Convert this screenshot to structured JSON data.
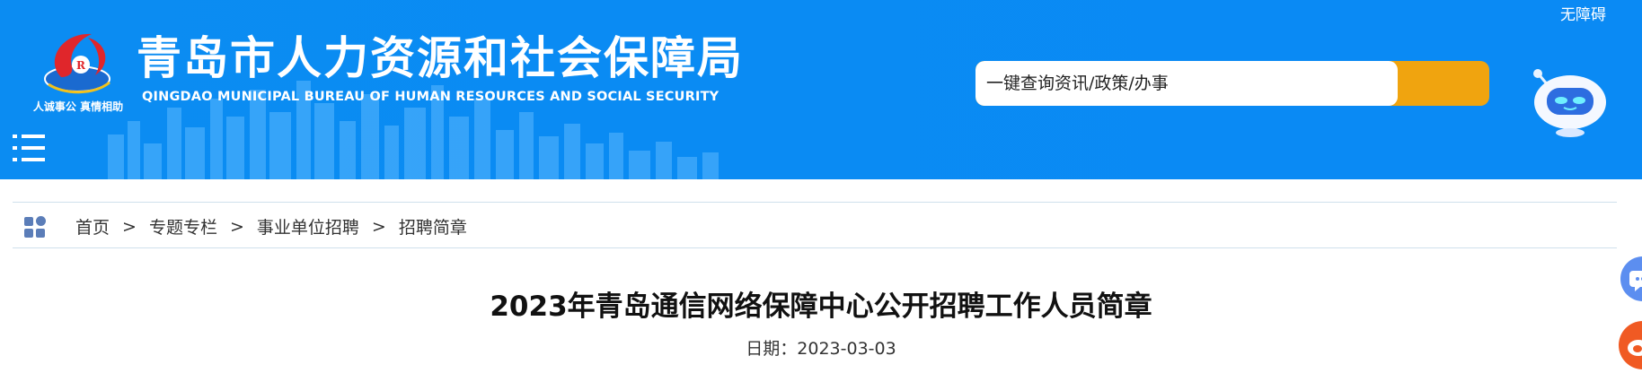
{
  "header": {
    "accessibility_label": "无障碍",
    "site_title": "青岛市人力资源和社会保障局",
    "site_subtitle": "QINGDAO MUNICIPAL BUREAU OF HUMAN RESOURCES AND SOCIAL SECURITY",
    "logo_caption": "人诚事公  真情相助",
    "logo_icon": "bureau-logo-icon",
    "menu_icon": "menu-icon",
    "robot_icon": "robot-assistant-icon",
    "colors": {
      "header_bg": "#0b8cf2",
      "search_button": "#f0a40f"
    }
  },
  "search": {
    "placeholder": "一键查询资讯/政策/办事",
    "button_icon": "search-button"
  },
  "breadcrumb": {
    "icon": "grid-icon",
    "items": [
      {
        "label": "首页"
      },
      {
        "label": "专题专栏"
      },
      {
        "label": "事业单位招聘"
      },
      {
        "label": "招聘简章"
      }
    ],
    "separator": ">"
  },
  "article": {
    "title": "2023年青岛通信网络保障中心公开招聘工作人员简章",
    "date_label": "日期：",
    "date_value": "2023-03-03"
  },
  "floating": {
    "chat_icon": "chat-icon",
    "weibo_icon": "weibo-icon"
  }
}
